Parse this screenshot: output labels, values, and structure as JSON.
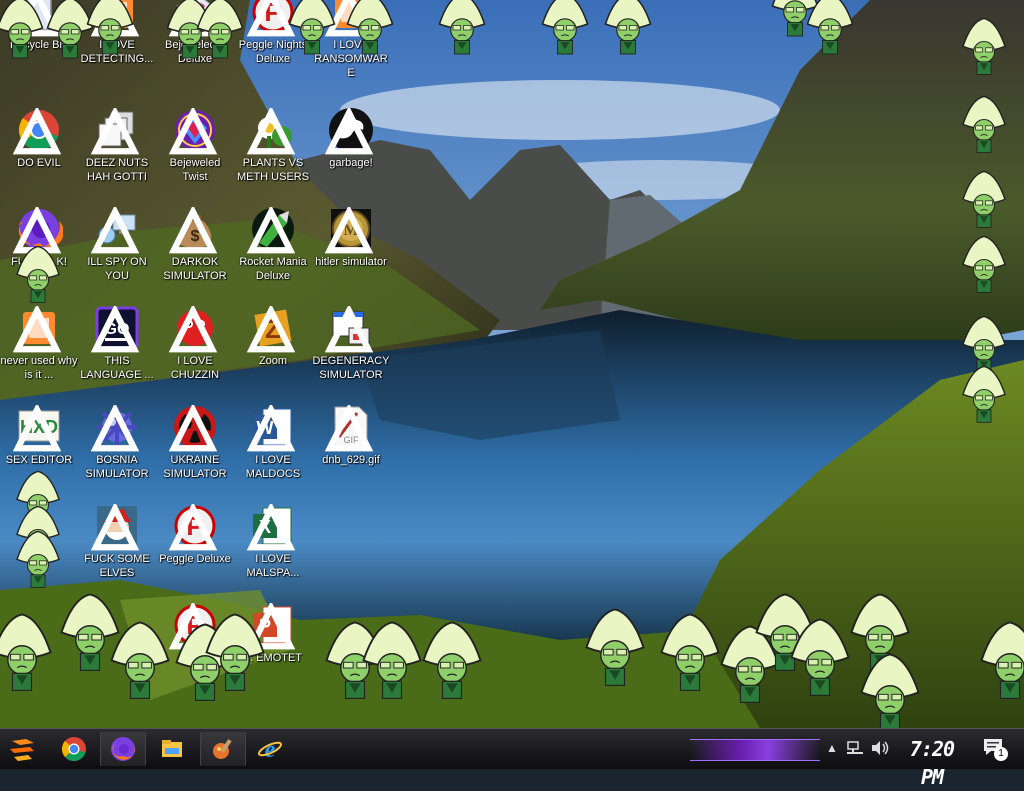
{
  "desktop": {
    "icons": [
      {
        "label": "Recycle Bin",
        "icon": "recycle-bin-icon"
      },
      {
        "label": "I LOVE DETECTING...",
        "icon": "app-icon"
      },
      {
        "label": "Bejeweled 2 Deluxe",
        "icon": "bejeweled-icon"
      },
      {
        "label": "Peggle Nights Deluxe",
        "icon": "peggle-icon"
      },
      {
        "label": "I LOVE RANSOMWARE",
        "icon": "app-icon"
      },
      {
        "label": "DO EVIL",
        "icon": "chrome-icon"
      },
      {
        "label": "DEEZ NUTS HAH GOTTI",
        "icon": "windows-stack-icon"
      },
      {
        "label": "Bejeweled Twist",
        "icon": "bejeweled-twist-icon"
      },
      {
        "label": "PLANTS VS METH USERS",
        "icon": "plants-icon"
      },
      {
        "label": "garbage!",
        "icon": "dragon-icon"
      },
      {
        "label": "FURRY...K!",
        "icon": "firefox-icon"
      },
      {
        "label": "ILL SPY ON YOU",
        "icon": "network-icon"
      },
      {
        "label": "DARKOK SIMULATOR",
        "icon": "money-bag-icon"
      },
      {
        "label": "Rocket Mania Deluxe",
        "icon": "rocket-icon"
      },
      {
        "label": "hitler simulator",
        "icon": "coin-icon"
      },
      {
        "label": "never used why is it ...",
        "icon": "app-icon"
      },
      {
        "label": "THIS LANGUAGE ...",
        "icon": "go-icon"
      },
      {
        "label": "I LOVE CHUZZIN",
        "icon": "chuzzle-icon"
      },
      {
        "label": "Zoom",
        "icon": "zuma-icon"
      },
      {
        "label": "DEGENERACY SIMULATOR",
        "icon": "window-app-icon"
      },
      {
        "label": "SEX EDITOR",
        "icon": "hxd-icon"
      },
      {
        "label": "BOSNIA SIMULATOR",
        "icon": "mine-icon"
      },
      {
        "label": "UKRAINE SIMULATOR",
        "icon": "radiation-icon"
      },
      {
        "label": "I LOVE MALDOCS",
        "icon": "word-icon"
      },
      {
        "label": "dnb_629.gif",
        "icon": "gif-file-icon"
      },
      {
        "label": "FUCK SOME ELVES",
        "icon": "santa-icon"
      },
      {
        "label": "Peggle Deluxe",
        "icon": "peggle-icon"
      },
      {
        "label": "I LOVE MALSPA...",
        "icon": "excel-icon"
      },
      {
        "label": "",
        "icon": "peggle-icon"
      },
      {
        "label": "... EMOTET",
        "icon": "powerpoint-icon"
      }
    ]
  },
  "taskbar": {
    "start_icon": "start-icon",
    "pinned": [
      {
        "name": "chrome",
        "icon": "chrome-icon"
      },
      {
        "name": "firefox",
        "icon": "firefox-icon"
      },
      {
        "name": "file-explorer",
        "icon": "folder-icon"
      },
      {
        "name": "paint",
        "icon": "paint-icon"
      },
      {
        "name": "internet-explorer",
        "icon": "ie-icon"
      }
    ],
    "clock": "7:20 PM",
    "notifications_count": "1"
  },
  "colors": {
    "accent_purple": "#8a3fe0",
    "taskbar_bg": "#1a1a1e",
    "peridot_green": "#c9e6a0"
  }
}
